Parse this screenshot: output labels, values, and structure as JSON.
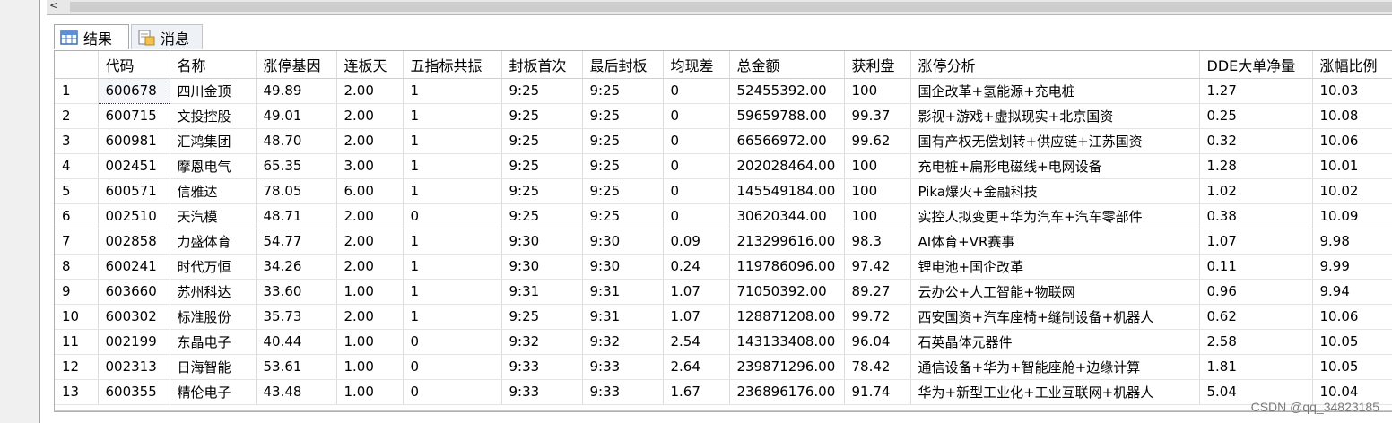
{
  "scrollbar": {
    "left_arrow": "<"
  },
  "tabs": [
    {
      "label": "结果",
      "icon": "grid-icon"
    },
    {
      "label": "消息",
      "icon": "message-icon"
    }
  ],
  "grid": {
    "columns": [
      "",
      "代码",
      "名称",
      "涨停基因",
      "连板天",
      "五指标共振",
      "封板首次",
      "最后封板",
      "均现差",
      "总金额",
      "获利盘",
      "涨停分析",
      "DDE大单净量",
      "涨幅比例"
    ],
    "rows": [
      [
        "1",
        "600678",
        "四川金顶",
        "49.89",
        "2.00",
        "1",
        "9:25",
        "9:25",
        "0",
        "52455392.00",
        "100",
        "国企改革+氢能源+充电桩",
        "1.27",
        "10.03"
      ],
      [
        "2",
        "600715",
        "文投控股",
        "49.01",
        "2.00",
        "1",
        "9:25",
        "9:25",
        "0",
        "59659788.00",
        "99.37",
        "影视+游戏+虚拟现实+北京国资",
        "0.25",
        "10.08"
      ],
      [
        "3",
        "600981",
        "汇鸿集团",
        "48.70",
        "2.00",
        "1",
        "9:25",
        "9:25",
        "0",
        "66566972.00",
        "99.62",
        "国有产权无偿划转+供应链+江苏国资",
        "0.32",
        "10.06"
      ],
      [
        "4",
        "002451",
        "摩恩电气",
        "65.35",
        "3.00",
        "1",
        "9:25",
        "9:25",
        "0",
        "202028464.00",
        "100",
        "充电桩+扁形电磁线+电网设备",
        "1.28",
        "10.01"
      ],
      [
        "5",
        "600571",
        "信雅达",
        "78.05",
        "6.00",
        "1",
        "9:25",
        "9:25",
        "0",
        "145549184.00",
        "100",
        "Pika爆火+金融科技",
        "1.02",
        "10.02"
      ],
      [
        "6",
        "002510",
        "天汽模",
        "48.71",
        "2.00",
        "0",
        "9:25",
        "9:25",
        "0",
        "30620344.00",
        "100",
        "实控人拟变更+华为汽车+汽车零部件",
        "0.38",
        "10.09"
      ],
      [
        "7",
        "002858",
        "力盛体育",
        "54.77",
        "2.00",
        "1",
        "9:30",
        "9:30",
        "0.09",
        "213299616.00",
        "98.3",
        "AI体育+VR赛事",
        "1.07",
        "9.98"
      ],
      [
        "8",
        "600241",
        "时代万恒",
        "34.26",
        "2.00",
        "1",
        "9:30",
        "9:30",
        "0.24",
        "119786096.00",
        "97.42",
        "锂电池+国企改革",
        "0.11",
        "9.99"
      ],
      [
        "9",
        "603660",
        "苏州科达",
        "33.60",
        "1.00",
        "1",
        "9:31",
        "9:31",
        "1.07",
        "71050392.00",
        "89.27",
        "云办公+人工智能+物联网",
        "0.96",
        "9.94"
      ],
      [
        "10",
        "600302",
        "标准股份",
        "35.73",
        "2.00",
        "1",
        "9:25",
        "9:31",
        "1.07",
        "128871208.00",
        "99.72",
        "西安国资+汽车座椅+缝制设备+机器人",
        "0.62",
        "10.06"
      ],
      [
        "11",
        "002199",
        "东晶电子",
        "40.44",
        "1.00",
        "0",
        "9:32",
        "9:32",
        "2.54",
        "143133408.00",
        "96.04",
        "石英晶体元器件",
        "2.58",
        "10.05"
      ],
      [
        "12",
        "002313",
        "日海智能",
        "53.61",
        "1.00",
        "0",
        "9:33",
        "9:33",
        "2.64",
        "239871296.00",
        "78.42",
        "通信设备+华为+智能座舱+边缘计算",
        "1.81",
        "10.05"
      ],
      [
        "13",
        "600355",
        "精伦电子",
        "43.48",
        "1.00",
        "0",
        "9:33",
        "9:33",
        "1.67",
        "236896176.00",
        "91.74",
        "华为+新型工业化+工业互联网+机器人",
        "5.04",
        "10.04"
      ]
    ]
  },
  "watermark": "CSDN @qq_34823185"
}
